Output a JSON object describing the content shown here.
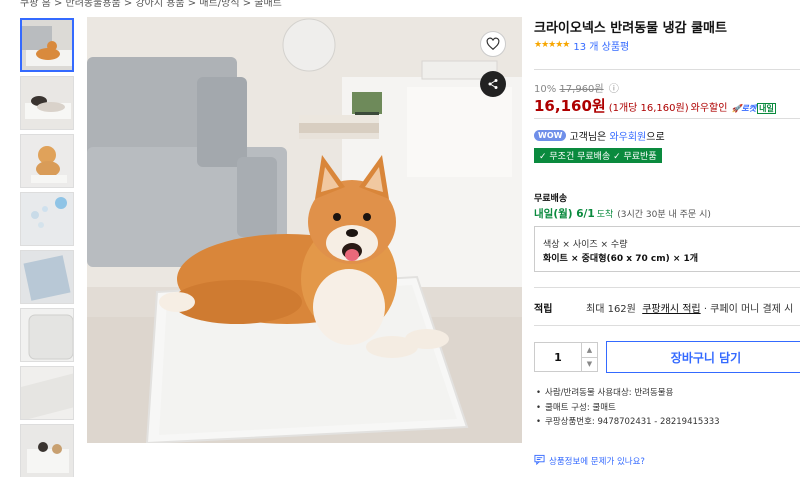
{
  "breadcrumb": "쿠팡 홈 > 반려동물용품 > 강아지 용품 > 매트/방석 > 쿨매트",
  "product": {
    "title": "크라이오넥스 반려동물 냉감 쿨매트",
    "stars": "★★★★★",
    "review_count": "13 개 상품평"
  },
  "price": {
    "discount_rate": "10%",
    "original_price": "17,960원",
    "sale_price": "16,160원",
    "unit_price": "(1개당 16,160원)",
    "wow_discount": "와우할인",
    "rocket_label": "로켓",
    "rocket_tag": "내일"
  },
  "membership": {
    "badge": "WOW",
    "text_before": "고객님은",
    "link": "와우회원",
    "text_after": "으로",
    "free_shipping_badge": "✓ 무조건 무료배송 ✓ 무료반품"
  },
  "shipping": {
    "label": "무료배송",
    "date": "내일(월) 6/1",
    "arrive": "도착",
    "cutoff": "(3시간 30분 내 주문 시)"
  },
  "options": {
    "labels": "색상 × 사이즈 × 수량",
    "values": "화이트 × 중대형(60 x 70 cm) × 1개"
  },
  "points": {
    "label": "적립",
    "text": "최대 162원",
    "link": "쿠팡캐시 적립",
    "rest": "· 쿠페이 머니 결제 시"
  },
  "purchase": {
    "quantity": "1",
    "cart_button": "장바구니 담기"
  },
  "specs": [
    "사람/반려동물 사용대상: 반려동물용",
    "쿨매트 구성: 쿨매트",
    "쿠팡상품번호: 9478702431 - 28219415333"
  ],
  "report": "상품정보에 문제가 있나요?",
  "colors": {
    "accent_blue": "#346aff",
    "price_red": "#ae0000",
    "green": "#0a8a3e",
    "star": "#f7a600"
  },
  "icons": {
    "heart": "heart-icon",
    "share": "share-icon",
    "report": "message-icon"
  }
}
